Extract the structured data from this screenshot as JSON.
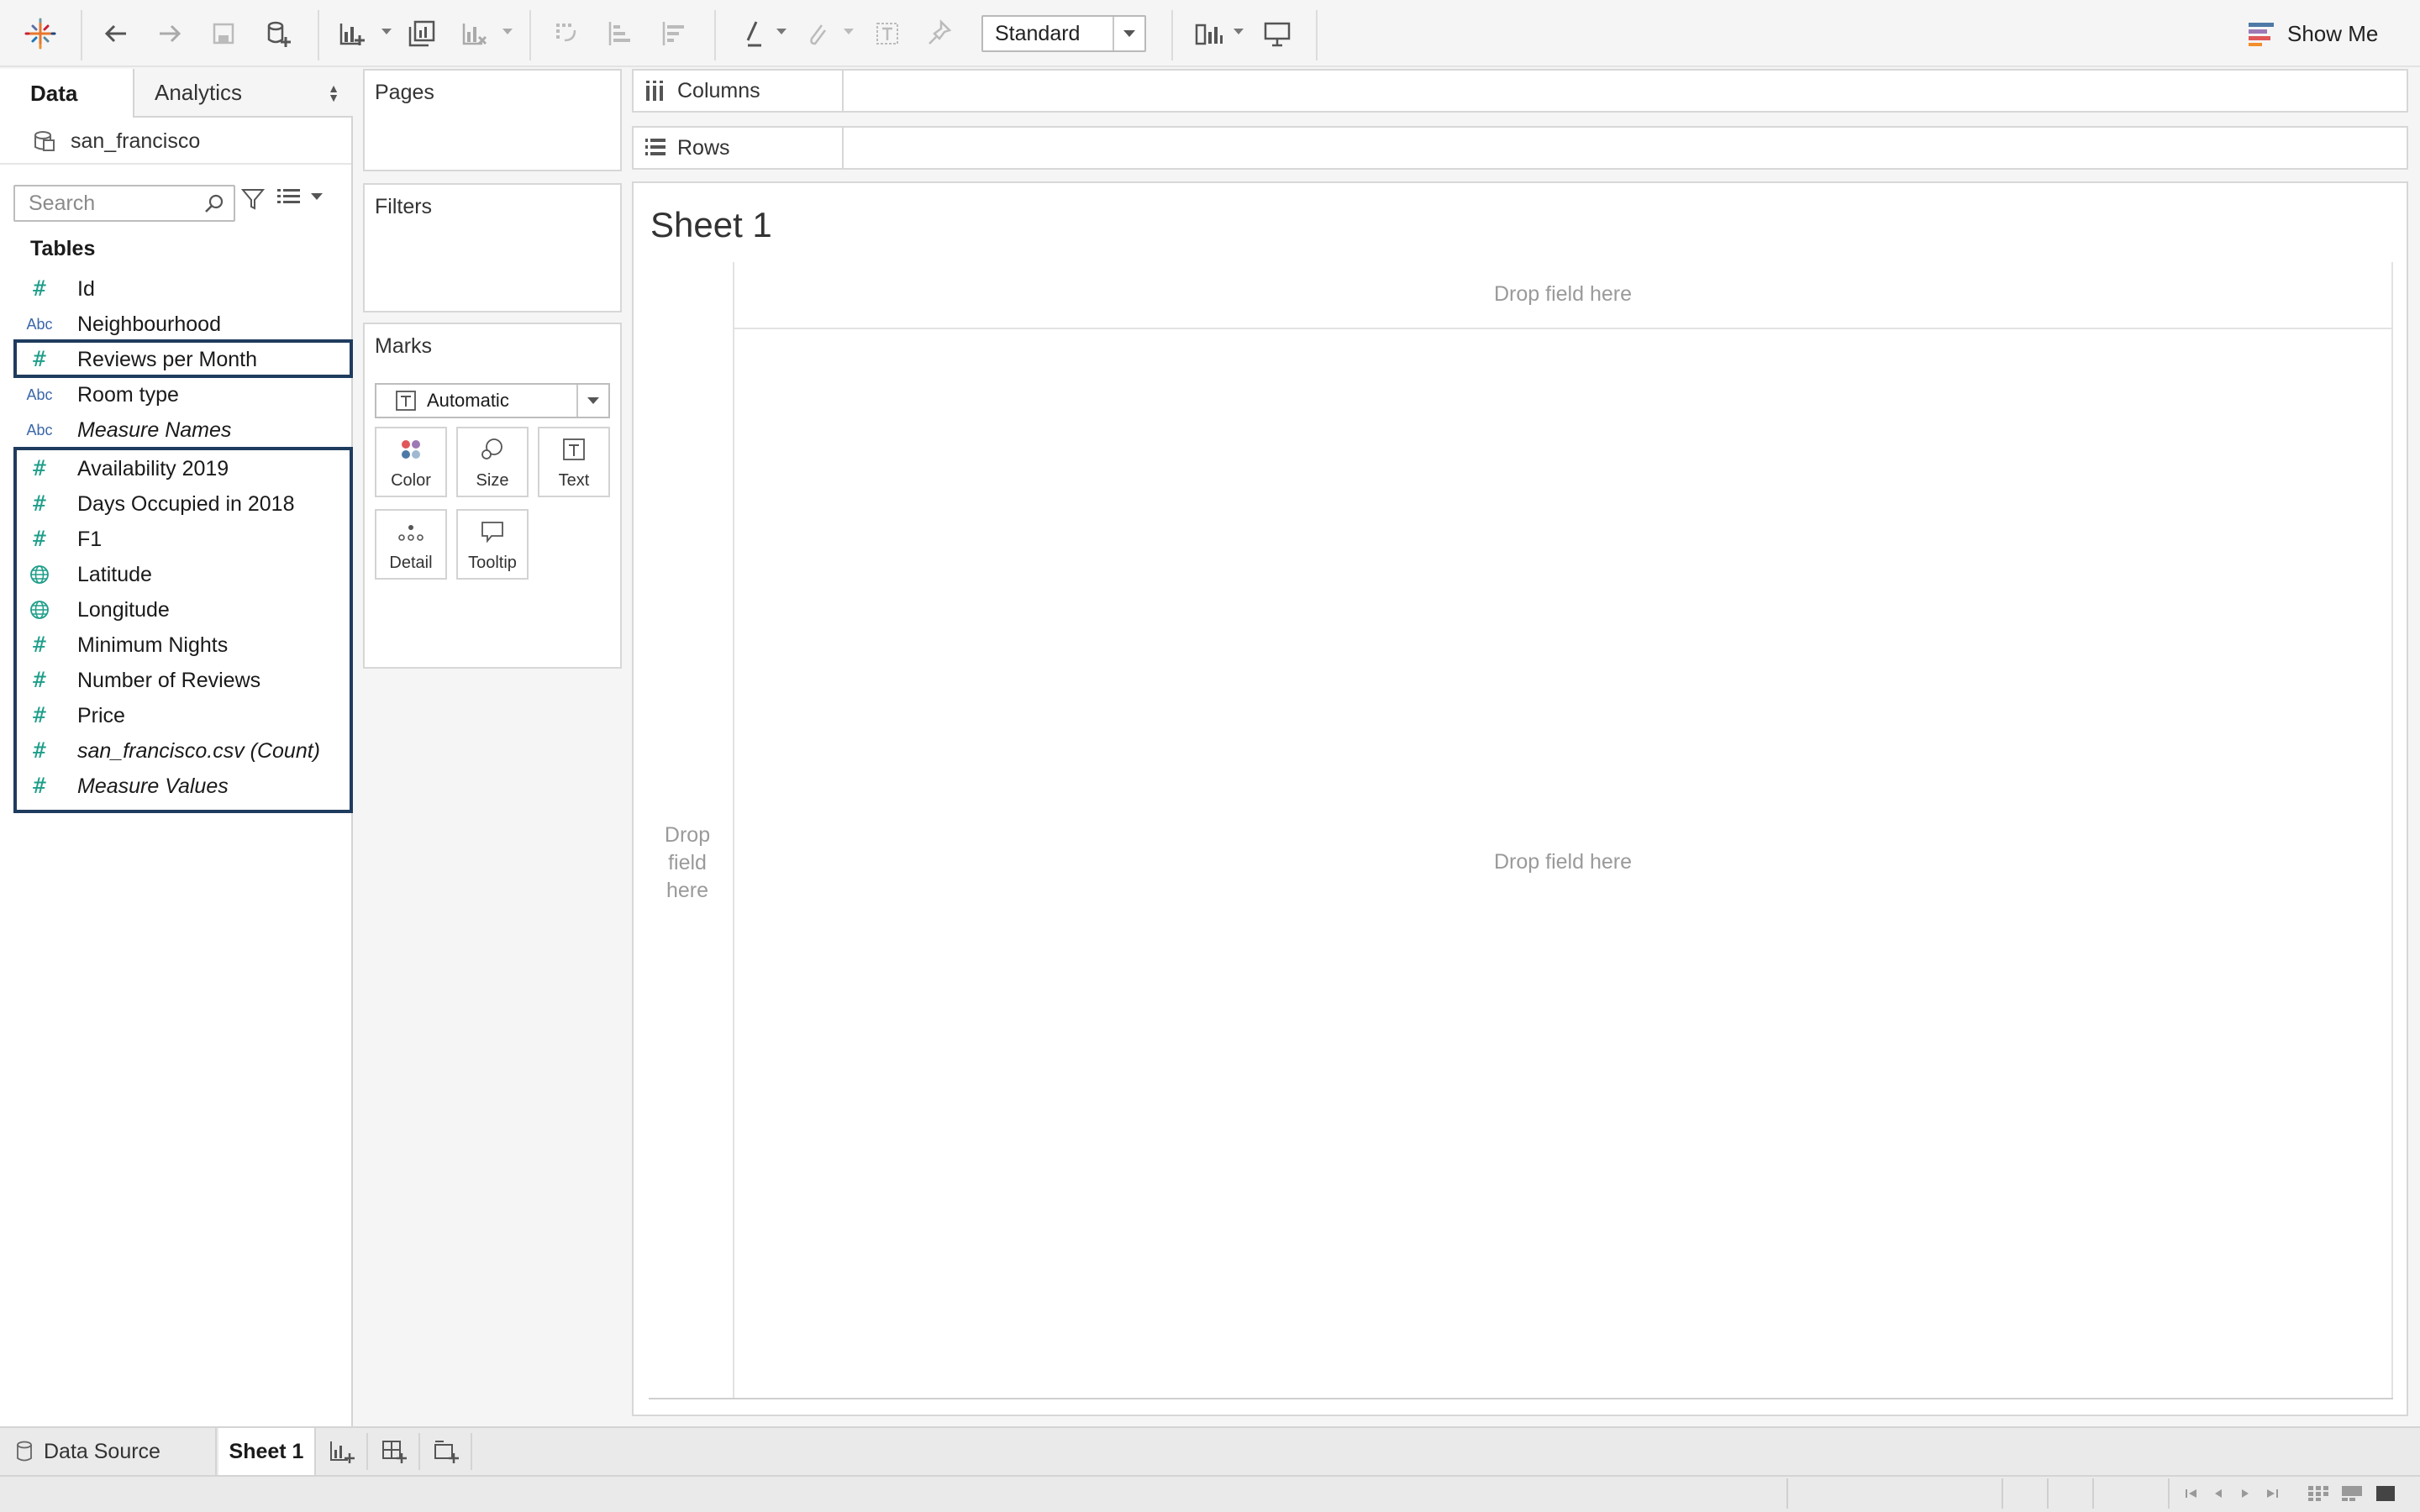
{
  "toolbar": {
    "standard_select": {
      "value": "Standard"
    },
    "show_me_label": "Show Me",
    "icons": [
      "tableau-logo-icon",
      "undo-icon",
      "redo-icon",
      "save-icon",
      "new-data-source-icon",
      "new-worksheet-icon",
      "duplicate-sheet-icon",
      "clear-sheet-icon",
      "swap-icon",
      "sort-ascending-icon",
      "sort-descending-icon",
      "highlight-icon",
      "attach-icon",
      "text-icon",
      "pin-icon",
      "fit-icon",
      "presentation-icon"
    ]
  },
  "data_pane": {
    "tabs": {
      "data": "Data",
      "analytics": "Analytics"
    },
    "data_source": "san_francisco",
    "search_placeholder": "Search",
    "tables_heading": "Tables",
    "fields": [
      {
        "name": "Id",
        "type": "number",
        "italic": false
      },
      {
        "name": "Neighbourhood",
        "type": "string",
        "italic": false
      },
      {
        "name": "Reviews per Month",
        "type": "number",
        "italic": false,
        "selected": true
      },
      {
        "name": "Room type",
        "type": "string",
        "italic": false
      },
      {
        "name": "Measure Names",
        "type": "string",
        "italic": true
      },
      {
        "name": "Availability 2019",
        "type": "number",
        "italic": false,
        "selected": true
      },
      {
        "name": "Days Occupied in 2018",
        "type": "number",
        "italic": false,
        "selected": true
      },
      {
        "name": "F1",
        "type": "number",
        "italic": false,
        "selected": true
      },
      {
        "name": "Latitude",
        "type": "geo",
        "italic": false,
        "selected": true
      },
      {
        "name": "Longitude",
        "type": "geo",
        "italic": false,
        "selected": true
      },
      {
        "name": "Minimum Nights",
        "type": "number",
        "italic": false,
        "selected": true
      },
      {
        "name": "Number of Reviews",
        "type": "number",
        "italic": false,
        "selected": true
      },
      {
        "name": "Price",
        "type": "number",
        "italic": false,
        "selected": true
      },
      {
        "name": "san_francisco.csv (Count)",
        "type": "number",
        "italic": true,
        "selected": true
      },
      {
        "name": "Measure Values",
        "type": "number",
        "italic": true,
        "selected": true
      }
    ],
    "type_glyphs": {
      "number": "#",
      "string": "Abc"
    }
  },
  "shelves": {
    "pages": "Pages",
    "filters": "Filters",
    "marks": "Marks",
    "columns": "Columns",
    "rows": "Rows"
  },
  "marks_card": {
    "mark_type": "Automatic",
    "buttons": [
      "Color",
      "Size",
      "Text",
      "Detail",
      "Tooltip"
    ]
  },
  "view": {
    "sheet_title": "Sheet 1",
    "drop_top": "Drop field here",
    "drop_center": "Drop field here",
    "drop_left": "Drop field here"
  },
  "bottom_tabs": {
    "data_source": "Data Source",
    "sheet1": "Sheet 1"
  },
  "colors": {
    "selection_border": "#1f3c5e",
    "number_icon": "#1e9e8a",
    "string_icon": "#3a67a8"
  }
}
